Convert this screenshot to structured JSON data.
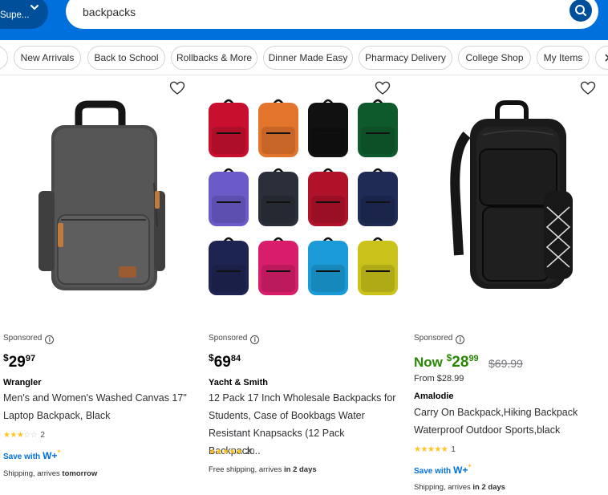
{
  "header": {
    "store_label": "Supe...",
    "search_value": "backpacks"
  },
  "nav": {
    "chips": [
      "New Arrivals",
      "Back to School",
      "Rollbacks & More",
      "Dinner Made Easy",
      "Pharmacy Delivery",
      "College Shop",
      "My Items"
    ]
  },
  "products": [
    {
      "sponsored": "Sponsored",
      "price_currency": "$",
      "price_dollars": "29",
      "price_cents": "97",
      "brand": "Wrangler",
      "title_line1": "Men's and Women's Washed Canvas 17\"",
      "title_line2": "Laptop Backpack, Black",
      "rating": 3,
      "review_count": "2",
      "save_with": "Save with",
      "wplus": "W+",
      "shipping_prefix": "Shipping, arrives ",
      "shipping_bold": "tomorrow"
    },
    {
      "sponsored": "Sponsored",
      "price_currency": "$",
      "price_dollars": "69",
      "price_cents": "84",
      "brand": "Yacht & Smith",
      "title_line1": "12 Pack 17 Inch Wholesale Backpacks for",
      "title_line2": "Students, Case of Bookbags Water",
      "title_line3": "Resistant Knapsacks (12 Pack Backpack...",
      "rating": 5,
      "review_count": "20",
      "shipping_prefix": "Free shipping, arrives ",
      "shipping_bold": "in 2 days"
    },
    {
      "sponsored": "Sponsored",
      "now_label": "Now ",
      "price_currency": "$",
      "price_dollars": "28",
      "price_cents": "99",
      "was_price": "$69.99",
      "from_price": "From $28.99",
      "brand": "Amalodie",
      "title_line1": "Carry On Backpack,Hiking Backpack",
      "title_line2": "Waterproof Outdoor Sports,black",
      "rating": 5,
      "review_count": "1",
      "save_with": "Save with",
      "wplus": "W+",
      "shipping_prefix": "Shipping, arrives ",
      "shipping_bold": "in 2 days"
    }
  ],
  "colors": {
    "brand_blue": "#0071dc",
    "dark_blue": "#004f9a",
    "rollback_green": "#2a8703",
    "star_yellow": "#ffc220"
  },
  "grid_backpack_colors": [
    "#c8102e",
    "#e2742c",
    "#111111",
    "#0f5a2c",
    "#6a5bc9",
    "#2a2f3a",
    "#b0122a",
    "#1f2a55",
    "#1e2452",
    "#d81e6a",
    "#1a9bd7",
    "#c9c21a"
  ]
}
